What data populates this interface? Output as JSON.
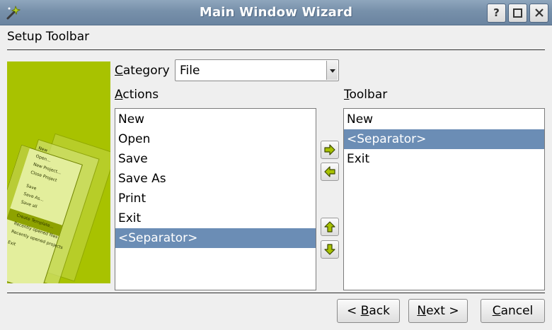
{
  "window": {
    "title": "Main Window Wizard",
    "help_glyph": "?",
    "maximize_glyph": "☐",
    "close_glyph": "✕",
    "icon": "wand-icon"
  },
  "page": {
    "heading": "Setup Toolbar"
  },
  "category": {
    "label_mnemonic": "C",
    "label_rest": "ategory",
    "selected": "File"
  },
  "actions": {
    "label_mnemonic": "A",
    "label_rest": "ctions",
    "items": [
      "New",
      "Open",
      "Save",
      "Save As",
      "Print",
      "Exit",
      "<Separator>"
    ],
    "selected_index": 6
  },
  "toolbar": {
    "label_mnemonic": "T",
    "label_rest": "oolbar",
    "items": [
      "New",
      "<Separator>",
      "Exit"
    ],
    "selected_index": 1
  },
  "side_image": {
    "menu_items": [
      "New",
      "Open...",
      "New Project...",
      "Close Project",
      "Save",
      "Save As...",
      "Save all",
      "Create Template...",
      "Recently opened files",
      "Recently opened projects",
      "Exit"
    ],
    "accent": "#a8c200"
  },
  "move_buttons": {
    "icons": [
      "arrow-right-icon",
      "arrow-left-icon",
      "arrow-up-icon",
      "arrow-down-icon"
    ],
    "arrow_color": "#a8c200"
  },
  "footer": {
    "back": {
      "prefix": "< ",
      "mnemonic": "B",
      "rest": "ack"
    },
    "next": {
      "mnemonic": "N",
      "rest": "ext >"
    },
    "cancel": {
      "mnemonic": "C",
      "rest": "ancel"
    }
  },
  "colors": {
    "titlebar": "#7790aa",
    "selection": "#6b8db5",
    "background": "#efefef"
  }
}
